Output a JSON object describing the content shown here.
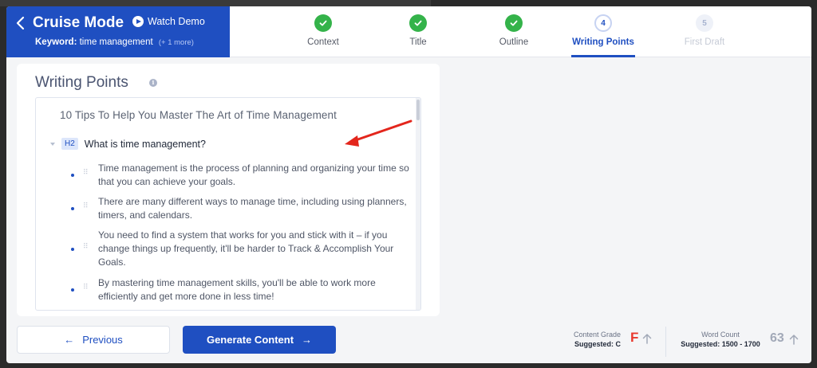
{
  "header": {
    "mode_title": "Cruise Mode",
    "watch_demo": "Watch Demo",
    "keyword_label": "Keyword:",
    "keyword_value": "time management",
    "keyword_more": "(+ 1 more)"
  },
  "steps": [
    {
      "label": "Context",
      "state": "done"
    },
    {
      "label": "Title",
      "state": "done"
    },
    {
      "label": "Outline",
      "state": "done"
    },
    {
      "label": "Writing Points",
      "state": "active",
      "number": "4"
    },
    {
      "label": "First Draft",
      "state": "pending",
      "number": "5"
    }
  ],
  "card": {
    "title": "Writing Points",
    "info_glyph": "i",
    "article_title": "10 Tips To Help You Master The Art of Time Management",
    "h2_badge": "H2",
    "h2_text": "What is time management?",
    "points": [
      "Time management is the process of planning and organizing your time so that you can achieve your goals.",
      "There are many different ways to manage time, including using planners, timers, and calendars.",
      "You need to find a system that works for you and stick with it – if you change things up frequently, it'll be harder to Track & Accomplish Your Goals.",
      "By mastering time management skills, you'll be able to work more efficiently and get more done in less time!"
    ]
  },
  "footer": {
    "previous_label": "Previous",
    "generate_label": "Generate Content",
    "content_grade_label": "Content Grade",
    "content_grade_suggested": "Suggested: C",
    "content_grade_value": "F",
    "word_count_label": "Word Count",
    "word_count_suggested": "Suggested: 1500 - 1700",
    "word_count_value": "63"
  },
  "colors": {
    "brand": "#1f4fc1",
    "done": "#34b34a",
    "grade_fail": "#e8392e",
    "annotation_arrow": "#e3261c"
  },
  "icons": [
    "back-arrow-icon",
    "play-icon",
    "check-icon",
    "expand-icon",
    "close-icon",
    "info-icon",
    "drag-handle-icon",
    "arrow-left-icon",
    "arrow-right-icon",
    "arrow-up-icon"
  ]
}
